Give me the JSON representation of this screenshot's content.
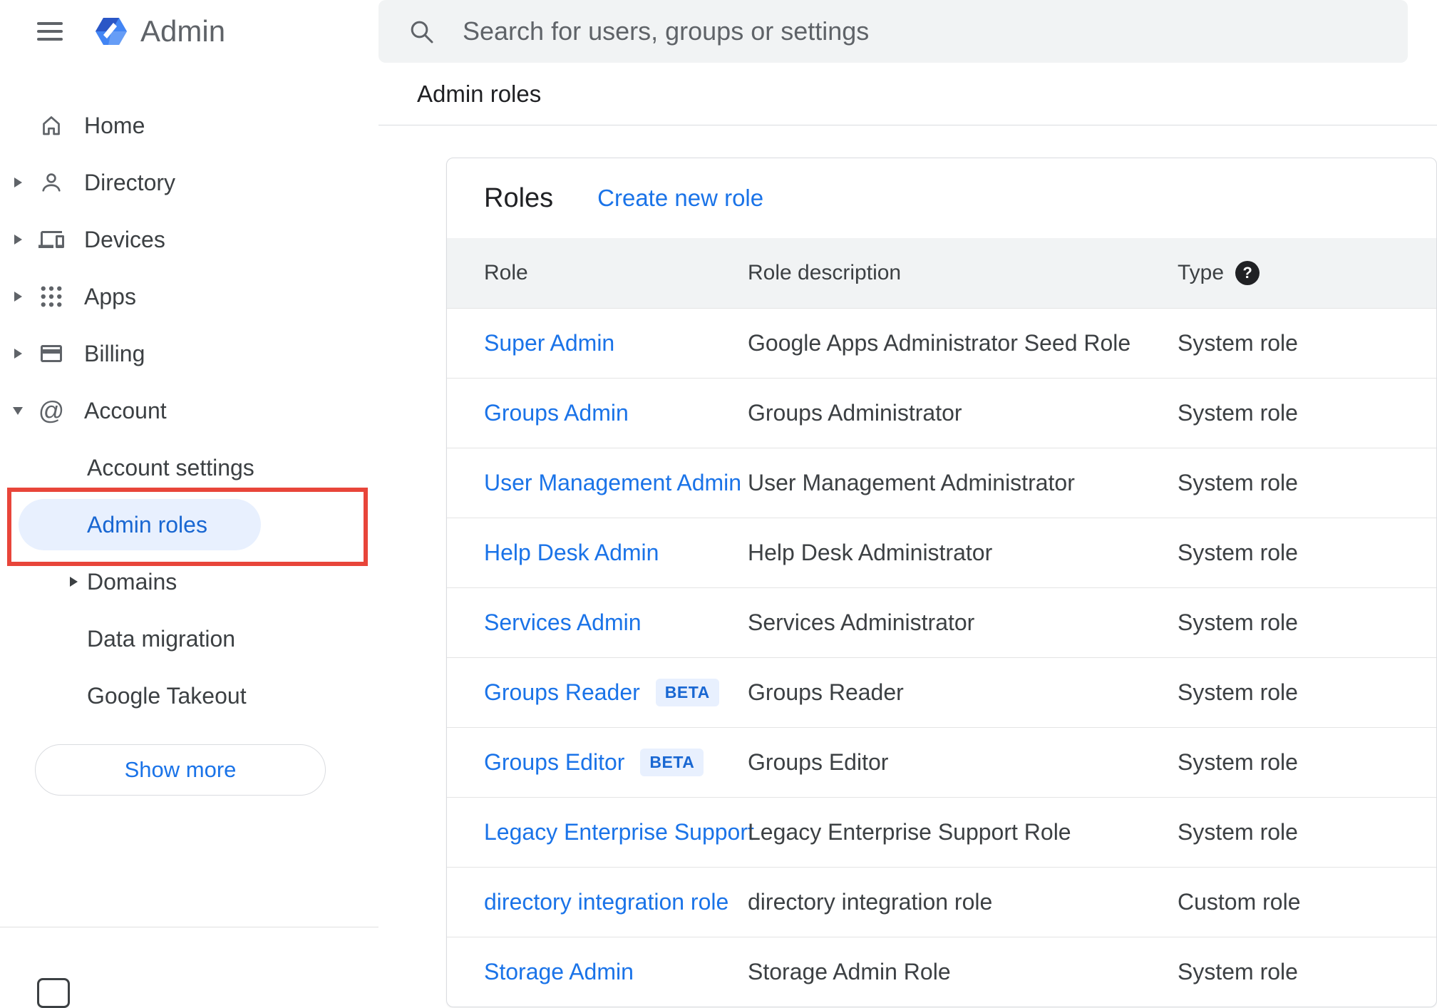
{
  "header": {
    "product_name": "Admin",
    "search_placeholder": "Search for users, groups or settings"
  },
  "sidebar": {
    "items": [
      {
        "label": "Home"
      },
      {
        "label": "Directory"
      },
      {
        "label": "Devices"
      },
      {
        "label": "Apps"
      },
      {
        "label": "Billing"
      },
      {
        "label": "Account"
      }
    ],
    "account_children": [
      {
        "label": "Account settings"
      },
      {
        "label": "Admin roles"
      },
      {
        "label": "Domains"
      },
      {
        "label": "Data migration"
      },
      {
        "label": "Google Takeout"
      }
    ],
    "show_more_label": "Show more"
  },
  "main": {
    "breadcrumb": "Admin roles",
    "card": {
      "title": "Roles",
      "create_link_label": "Create new role",
      "beta_label": "BETA",
      "columns": [
        "Role",
        "Role description",
        "Type"
      ],
      "rows": [
        {
          "role": "Super Admin",
          "beta": false,
          "description": "Google Apps Administrator Seed Role",
          "type": "System role"
        },
        {
          "role": "Groups Admin",
          "beta": false,
          "description": "Groups Administrator",
          "type": "System role"
        },
        {
          "role": "User Management Admin",
          "beta": false,
          "description": "User Management Administrator",
          "type": "System role"
        },
        {
          "role": "Help Desk Admin",
          "beta": false,
          "description": "Help Desk Administrator",
          "type": "System role"
        },
        {
          "role": "Services Admin",
          "beta": false,
          "description": "Services Administrator",
          "type": "System role"
        },
        {
          "role": "Groups Reader",
          "beta": true,
          "description": "Groups Reader",
          "type": "System role"
        },
        {
          "role": "Groups Editor",
          "beta": true,
          "description": "Groups Editor",
          "type": "System role"
        },
        {
          "role": "Legacy Enterprise Support",
          "beta": false,
          "description": "Legacy Enterprise Support Role",
          "type": "System role"
        },
        {
          "role": "directory integration role",
          "beta": false,
          "description": "directory integration role",
          "type": "Custom role"
        },
        {
          "role": "Storage Admin",
          "beta": false,
          "description": "Storage Admin Role",
          "type": "System role"
        }
      ]
    }
  },
  "icons": {
    "menu": "hamburger",
    "logo": "blue-hexagon",
    "home": "house",
    "directory": "person",
    "devices": "laptop-and-phone",
    "apps": "grid-dots",
    "billing": "credit-card",
    "account": "at-sign",
    "search": "magnifier",
    "type_help": "question-mark-circle",
    "expand": "chevron-right",
    "collapse": "chevron-down"
  },
  "colors": {
    "accent": "#1a73e8",
    "active_item_bg": "#e8f0fe",
    "active_item_text": "#1967d2",
    "table_header_bg": "#f1f3f4",
    "annotation_red": "#e8453a",
    "beta_bg": "#e8f0fe",
    "beta_text": "#1967d2"
  }
}
